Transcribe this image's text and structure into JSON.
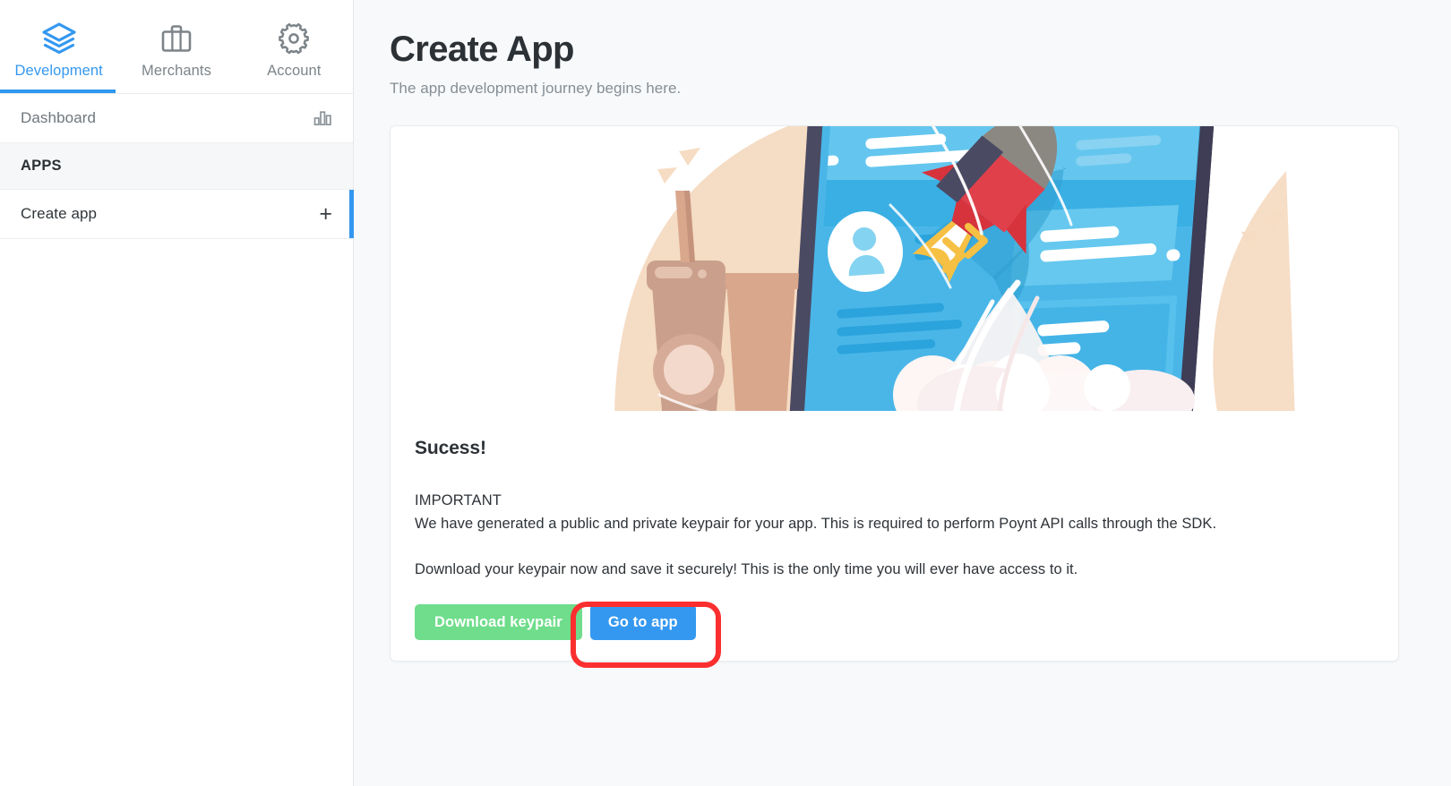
{
  "sidebar": {
    "topnav": [
      {
        "label": "Development",
        "icon": "layers-icon",
        "active": true
      },
      {
        "label": "Merchants",
        "icon": "briefcase-icon",
        "active": false
      },
      {
        "label": "Account",
        "icon": "gear-icon",
        "active": false
      }
    ],
    "rows": [
      {
        "label": "Dashboard",
        "icon": "bar-chart-icon"
      }
    ],
    "section_label": "APPS",
    "create_row": {
      "label": "Create app",
      "icon": "plus-icon"
    }
  },
  "header": {
    "title": "Create App",
    "subtitle": "The app development journey begins here."
  },
  "card": {
    "illustration_name": "rocket-tablet-coffee-illustration",
    "success_heading": "Sucess!",
    "important_heading": "IMPORTANT",
    "paragraph_1": "We have generated a public and private keypair for your app. This is required to perform Poynt API calls through the SDK.",
    "paragraph_2": "Download your keypair now and save it securely! This is the only time you will ever have access to it.",
    "buttons": {
      "download_label": "Download keypair",
      "goto_label": "Go to app"
    }
  },
  "annotation": {
    "name": "red-highlight-rectangle",
    "target": "Go to app",
    "color": "#fb2f2f"
  },
  "colors": {
    "accent_blue": "#3498f0",
    "success_green": "#6fdd8b",
    "page_bg": "#f7f9fa",
    "text_dark": "#2c3136",
    "text_muted": "#868e95",
    "annotation_red": "#fb2f2f"
  }
}
